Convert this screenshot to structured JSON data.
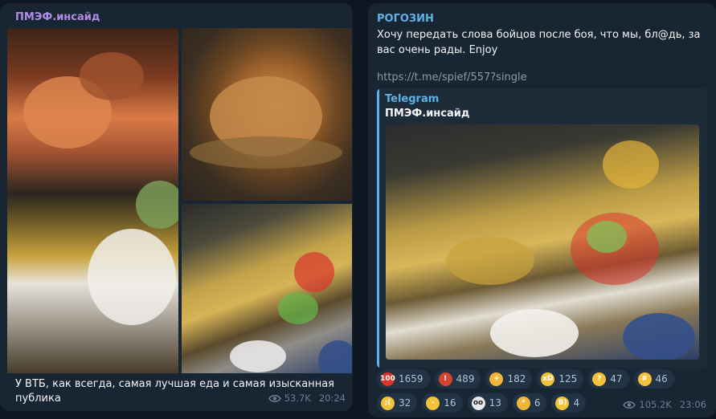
{
  "left_post": {
    "sender": "ПМЭФ.инсайд",
    "caption": "У ВТБ, как всегда, самая лучшая еда и самая изысканная публика",
    "views": "53.7K",
    "time": "20:24"
  },
  "right_post": {
    "sender": "РОГОЗИН",
    "text": "Хочу передать слова бойцов после боя, что мы, бл@дь, за вас очень рады. Enjoy",
    "link": "https://t.me/spief/557?single",
    "preview": {
      "site": "Telegram",
      "title": "ПМЭФ.инсайд"
    },
    "views": "105.2K",
    "time": "23:06",
    "reactions": [
      {
        "icon": "hundred-icon",
        "glyph": "100",
        "color": "#d9342b",
        "count": "1659"
      },
      {
        "icon": "angry-face-icon",
        "glyph": "!",
        "color": "#d6432f",
        "count": "489"
      },
      {
        "icon": "thumbs-up-icon",
        "glyph": "+",
        "color": "#f0b63a",
        "count": "182"
      },
      {
        "icon": "laughing-face-icon",
        "glyph": "xD",
        "color": "#f3c13a",
        "count": "125"
      },
      {
        "icon": "raised-eyebrow-face-icon",
        "glyph": "?",
        "color": "#f3c13a",
        "count": "47"
      },
      {
        "icon": "grimacing-face-icon",
        "glyph": "#",
        "color": "#f3c13a",
        "count": "46"
      },
      {
        "icon": "crying-face-icon",
        "glyph": ";(",
        "color": "#f3c13a",
        "count": "32"
      },
      {
        "icon": "neutral-face-icon",
        "glyph": "-",
        "color": "#f3c13a",
        "count": "16"
      },
      {
        "icon": "eyes-icon",
        "glyph": "oo",
        "color": "#e8e8e8",
        "count": "13"
      },
      {
        "icon": "clapping-hands-icon",
        "glyph": "*",
        "color": "#f0b63a",
        "count": "6"
      },
      {
        "icon": "sunglasses-face-icon",
        "glyph": "B)",
        "color": "#f3c13a",
        "count": "4"
      }
    ]
  }
}
